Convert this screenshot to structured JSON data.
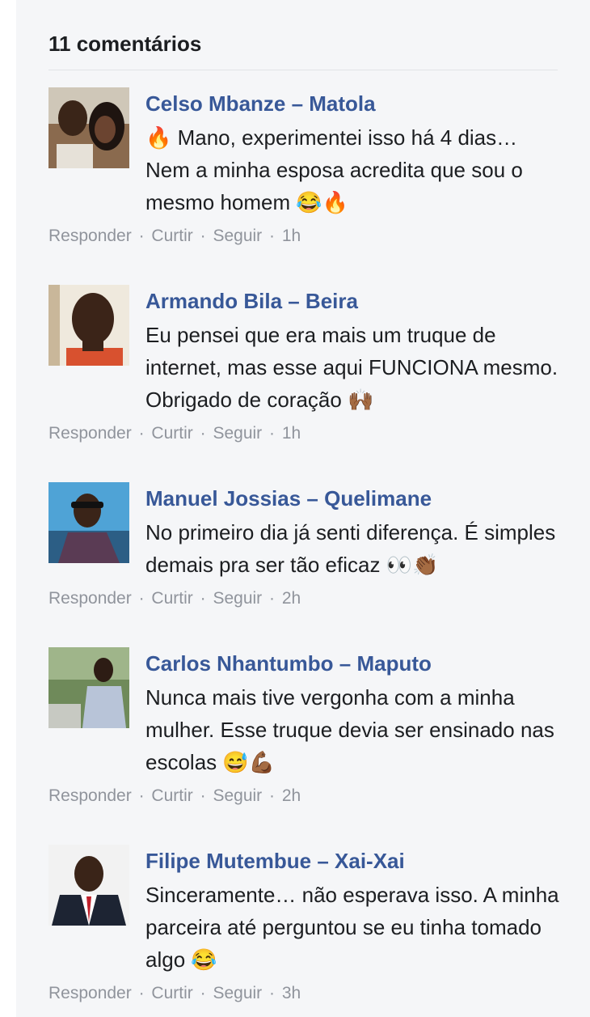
{
  "header": {
    "count_label": "11 comentários"
  },
  "actions": {
    "reply": "Responder",
    "like": "Curtir",
    "follow": "Seguir",
    "separator": "·"
  },
  "comments": [
    {
      "author": "Celso Mbanze – Matola",
      "text": "🔥 Mano, experimentei isso há 4 dias… Nem a minha esposa acredita que sou o mesmo homem 😂🔥",
      "time": "1h"
    },
    {
      "author": "Armando Bila – Beira",
      "text": "Eu pensei que era mais um truque de internet, mas esse aqui FUNCIONA mesmo. Obrigado de coração 🙌🏾",
      "time": "1h"
    },
    {
      "author": "Manuel Jossias – Quelimane",
      "text": "No primeiro dia já senti diferença. É simples demais pra ser tão eficaz 👀👏🏾",
      "time": "2h"
    },
    {
      "author": "Carlos Nhantumbo – Maputo",
      "text": "Nunca mais tive vergonha com a minha mulher. Esse truque devia ser ensinado nas escolas 😅💪🏾",
      "time": "2h"
    },
    {
      "author": "Filipe Mutembue – Xai-Xai",
      "text": "Sinceramente… não esperava isso. A minha parceira até perguntou se eu tinha tomado algo 😂",
      "time": "3h"
    }
  ]
}
